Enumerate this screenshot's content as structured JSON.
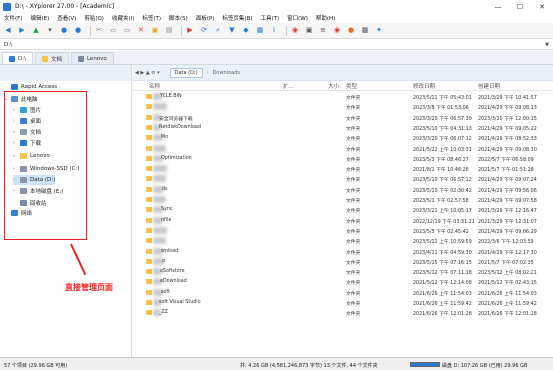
{
  "window": {
    "title": "D:\\ - XYplorer 27.00 - [Academic]",
    "min_glyph": "—",
    "max_glyph": "☐",
    "close_glyph": "✕"
  },
  "menu": [
    "文件(F)",
    "编辑(E)",
    "查看(V)",
    "剪贴(O)",
    "收藏夹(I)",
    "标签(T)",
    "脚本(S)",
    "面板(P)",
    "标签页集(B)",
    "工具(T)",
    "窗口(W)",
    "帮助(H)"
  ],
  "toolbar_icons": [
    "back-icon",
    "forward-icon",
    "up-icon",
    "browse-icon",
    "location-icon",
    "search-icon",
    "cut-icon",
    "copy-icon",
    "paste-icon",
    "delete-icon",
    "new-folder-icon",
    "properties-icon",
    "play-icon",
    "refresh-icon",
    "find-icon",
    "filter-icon",
    "tag-icon",
    "layout-icon",
    "info-icon",
    "red-icon",
    "photo-icon",
    "list-icon",
    "chrome-icon",
    "ball-icon",
    "grid-icon",
    "settings-icon"
  ],
  "address": {
    "value": "D:\\",
    "drop_glyph": "▼"
  },
  "tabs": [
    {
      "label": "D:\\",
      "active": true
    },
    {
      "label": "文档",
      "active": false
    },
    {
      "label": "Lenovo",
      "active": false
    }
  ],
  "tree": [
    {
      "label": "Rapid Access",
      "depth": 0,
      "icon": "star-icon",
      "arrow": "",
      "selected": false
    },
    {
      "label": "此电脑",
      "depth": 0,
      "icon": "computer-icon",
      "arrow": "⌄",
      "selected": false
    },
    {
      "label": "图片",
      "depth": 1,
      "icon": "pictures-icon",
      "arrow": "›",
      "selected": false
    },
    {
      "label": "桌面",
      "depth": 1,
      "icon": "desktop-icon",
      "arrow": "›",
      "selected": false
    },
    {
      "label": "文档",
      "depth": 1,
      "icon": "documents-icon",
      "arrow": "›",
      "selected": false
    },
    {
      "label": "下载",
      "depth": 1,
      "icon": "downloads-icon",
      "arrow": "›",
      "selected": false
    },
    {
      "label": "Lenovo",
      "depth": 1,
      "icon": "user-folder-icon",
      "arrow": "›",
      "selected": false
    },
    {
      "label": "Windows-SSD (C:)",
      "depth": 1,
      "icon": "drive-icon",
      "arrow": "›",
      "selected": false
    },
    {
      "label": "Data (D:)",
      "depth": 1,
      "icon": "drive-icon",
      "arrow": "›",
      "selected": true
    },
    {
      "label": "本地磁盘 (E:)",
      "depth": 1,
      "icon": "drive-icon",
      "arrow": "›",
      "selected": false
    },
    {
      "label": "回收站",
      "depth": 1,
      "icon": "recycle-bin-icon",
      "arrow": "",
      "selected": false
    },
    {
      "label": "网络",
      "depth": 0,
      "icon": "network-icon",
      "arrow": "›",
      "selected": false
    }
  ],
  "annotation": "直接管理页面",
  "path": {
    "nav": "◀ ▶ ▲ ≡ ▾",
    "segments": [
      "Data (D:)",
      "Downloads"
    ]
  },
  "columns": {
    "name": "名称",
    "ext": "扩...",
    "size": "大小",
    "type": "类型",
    "modified": "修改日期",
    "created": "创建日期"
  },
  "files": [
    {
      "name": "YCLE.BIN",
      "blur": 12,
      "type": "文件夹",
      "modified": "2023/5/11 下午 05:43:01",
      "created": "2021/3/29 下午 10:41:57"
    },
    {
      "name": "",
      "blur": 22,
      "type": "文件夹",
      "modified": "2023/3/8 下午 01:53:06",
      "created": "2021/4/29 下午 09:08:13"
    },
    {
      "name": "安全浏览器下载",
      "blur": 10,
      "type": "文件夹",
      "modified": "2023/3/20 下午 06:57:30",
      "created": "2023/3/20 下午 12:00:15"
    },
    {
      "name": "NetdiskDownload",
      "blur": 10,
      "type": "文件夹",
      "modified": "2023/5/10 下午 04:31:13",
      "created": "2021/4/29 下午 09:05:22"
    },
    {
      "name": "Mo",
      "blur": 14,
      "type": "文件夹",
      "modified": "2023/3/20 下午 06:07:12",
      "created": "2021/4/29 下午 08:52:33"
    },
    {
      "name": "",
      "blur": 20,
      "type": "文件夹",
      "modified": "2021/5/22 上午 10:03:31",
      "created": "2021/4/29 下午 09:08:30"
    },
    {
      "name": "Optimization",
      "blur": 14,
      "type": "文件夹",
      "modified": "2023/5/3 下午 08:46:27",
      "created": "2022/5/7 下午 06:58:09"
    },
    {
      "name": "",
      "blur": 22,
      "type": "文件夹",
      "modified": "2021/8/2 下午 10:46:26",
      "created": "2021/5/7 下午 01:51:28"
    },
    {
      "name": "",
      "blur": 20,
      "type": "文件夹",
      "modified": "2023/5/10 下午 06:57:12",
      "created": "2021/4/29 下午 09:07:24"
    },
    {
      "name": "ds",
      "blur": 16,
      "type": "文件夹",
      "modified": "2023/5/10 下午 02:30:42",
      "created": "2021/4/29 下午 09:56:06"
    },
    {
      "name": "",
      "blur": 20,
      "type": "文件夹",
      "modified": "2023/5/1 下午 02:57:58",
      "created": "2021/4/29 下午 09:07:58"
    },
    {
      "name": "Sync",
      "blur": 14,
      "type": "文件夹",
      "modified": "2023/3/21 上午 10:05:17",
      "created": "2021/3/29 下午 12:16:47"
    },
    {
      "name": "nfile",
      "blur": 14,
      "type": "文件夹",
      "modified": "2022/12/19 下午 03:31:21",
      "created": "2021/3/29 下午 12:31:07"
    },
    {
      "name": "",
      "blur": 22,
      "type": "文件夹",
      "modified": "2023/5/5 下午 02:45:42",
      "created": "2021/4/29 下午 09:06:29"
    },
    {
      "name": "",
      "blur": 20,
      "type": "文件夹",
      "modified": "2023/5/11 上午 10:59:59",
      "created": "2022/3/6 下午 12:03:59"
    },
    {
      "name": "wnload",
      "blur": 14,
      "type": "文件夹",
      "modified": "2023/4/11 下午 04:59:30",
      "created": "2021/4/29 下午 12:17:30"
    },
    {
      "name": "o",
      "blur": 16,
      "type": "文件夹",
      "modified": "2023/5/15 下午 07:16:15",
      "created": "2021/5/7 下午 07:02:35"
    },
    {
      "name": "oSoftstore",
      "blur": 12,
      "type": "文件夹",
      "modified": "2023/5/12 下午 07:11:18",
      "created": "2023/5/12 上午 08:02:21"
    },
    {
      "name": "eDownload",
      "blur": 12,
      "type": "文件夹",
      "modified": "2021/5/12 下午 12:14:08",
      "created": "2021/5/12 下午 02:43:15"
    },
    {
      "name": "soft",
      "blur": 14,
      "type": "文件夹",
      "modified": "2021/6/26 上午 11:54:03",
      "created": "2021/6/26 上午 11:54:03"
    },
    {
      "name": "soft Visual Studio",
      "blur": 10,
      "type": "文件夹",
      "modified": "2021/6/26 上午 11:59:42",
      "created": "2021/6/26 上午 11:59:42"
    },
    {
      "name": "_ZZ",
      "blur": 10,
      "type": "文件夹",
      "modified": "2021/6/26 下午 12:01:28",
      "created": "2021/6/26 下午 12:01:28"
    }
  ],
  "status": {
    "count": "57 个项目 (29.96 GB 可用)",
    "total": "共: 4.26 GB (4,581,246,873 字节) 13 个文件, 44 个文件夹",
    "drive": "磁盘 D: 107.26 GB (已用) 29.96 GB"
  }
}
